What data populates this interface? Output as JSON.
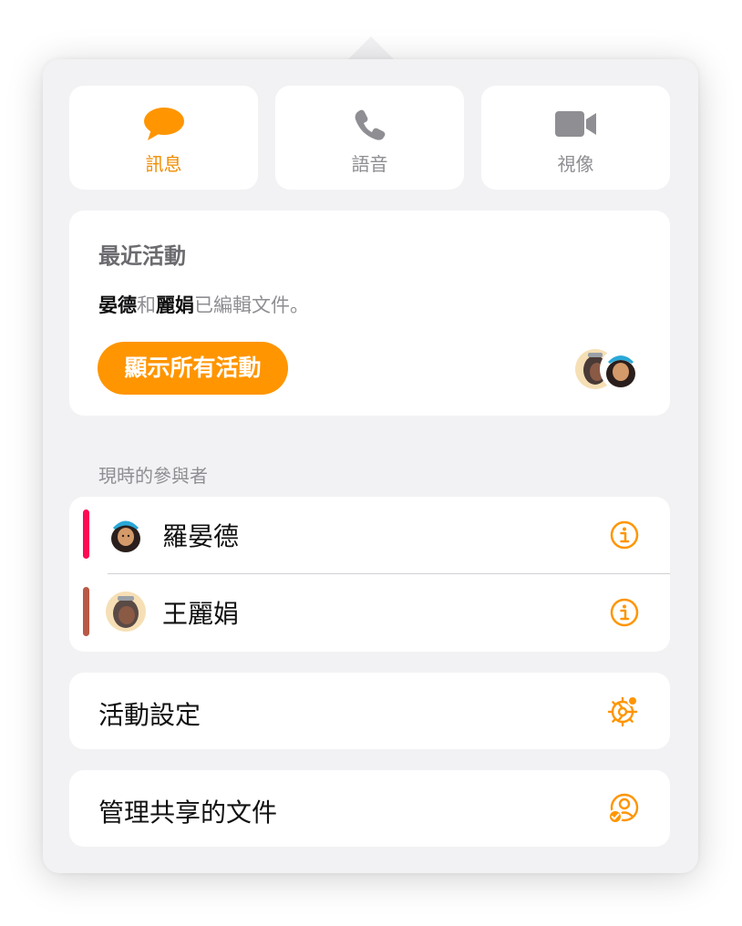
{
  "comm_buttons": [
    {
      "label": "訊息",
      "icon": "message-bubble-icon",
      "active": true
    },
    {
      "label": "語音",
      "icon": "phone-icon",
      "active": false
    },
    {
      "label": "視像",
      "icon": "video-camera-icon",
      "active": false
    }
  ],
  "activity": {
    "title": "最近活動",
    "name_a": "晏德",
    "conj": "和",
    "name_b": "麗娟",
    "suffix": "已編輯文件。",
    "button_label": "顯示所有活動"
  },
  "participants": {
    "label": "現時的參與者",
    "items": [
      {
        "name": "羅晏德",
        "color": "#ff0a54",
        "icon": "info-icon"
      },
      {
        "name": "王麗娟",
        "color": "#b85a45",
        "icon": "info-icon"
      }
    ]
  },
  "menu": {
    "activity_settings": "活動設定",
    "manage_shared": "管理共享的文件"
  },
  "colors": {
    "accent": "#ff9500",
    "accent_text": "#f08c00",
    "panel_bg": "#f2f2f4",
    "card_bg": "#ffffff"
  }
}
